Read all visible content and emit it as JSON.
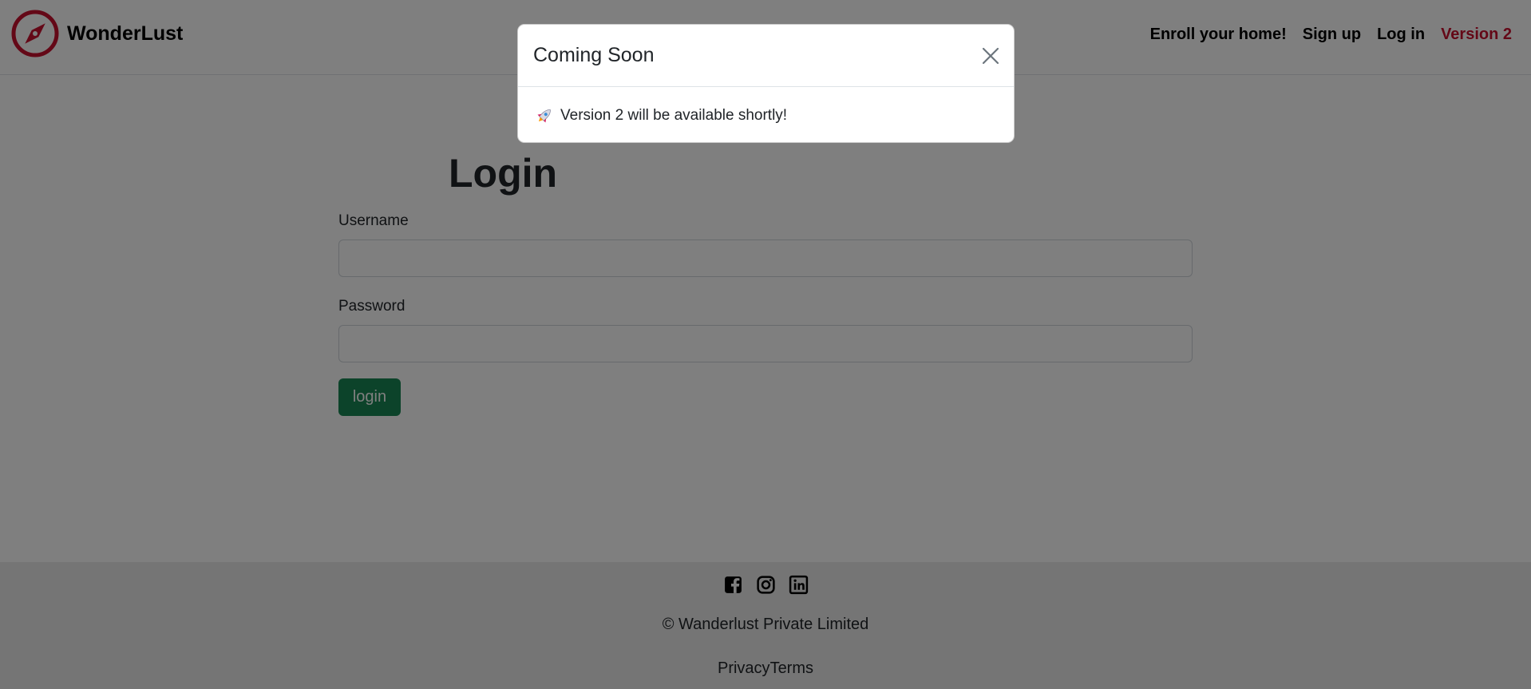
{
  "brand": {
    "name": "WonderLust",
    "icon": "compass-icon",
    "accent": "#c8102e"
  },
  "nav": {
    "links": [
      {
        "label": "Enroll your home!"
      },
      {
        "label": "Sign up"
      },
      {
        "label": "Log in"
      },
      {
        "label": "Version 2"
      }
    ]
  },
  "login": {
    "title": "Login",
    "username_label": "Username",
    "username_value": "",
    "password_label": "Password",
    "password_value": "",
    "submit_label": "login",
    "button_color": "#198754"
  },
  "footer": {
    "socials": [
      "facebook-icon",
      "instagram-icon",
      "linkedin-icon"
    ],
    "copyright": "© Wanderlust Private Limited",
    "links": [
      "Privacy",
      "Terms"
    ]
  },
  "modal": {
    "title": "Coming Soon",
    "icon": "rocket-icon",
    "message": "Version 2 will be available shortly!",
    "close_icon": "close-icon"
  }
}
